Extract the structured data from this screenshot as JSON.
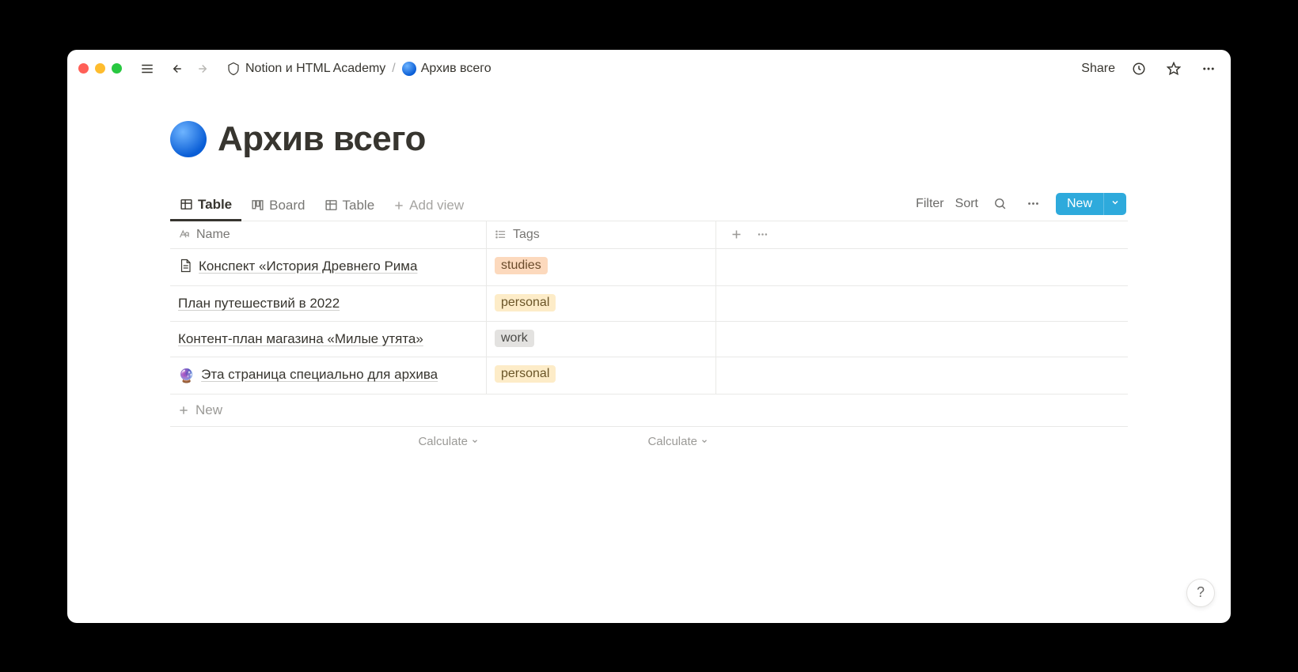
{
  "breadcrumb": {
    "root": "Notion и HTML Academy",
    "current": "Архив всего"
  },
  "topbar": {
    "share": "Share"
  },
  "page": {
    "title": "Архив всего"
  },
  "views": {
    "items": [
      {
        "label": "Table",
        "active": true,
        "type": "table"
      },
      {
        "label": "Board",
        "active": false,
        "type": "board"
      },
      {
        "label": "Table",
        "active": false,
        "type": "table"
      }
    ],
    "add_label": "Add view",
    "filter": "Filter",
    "sort": "Sort",
    "new": "New"
  },
  "columns": {
    "name": "Name",
    "tags": "Tags"
  },
  "rows": [
    {
      "icon": "page",
      "name": "Конспект «История Древнего Рима",
      "tag": "studies",
      "tag_class": "studies"
    },
    {
      "icon": "",
      "name": "План путешествий в 2022",
      "tag": "personal",
      "tag_class": "personal"
    },
    {
      "icon": "",
      "name": "Контент-план магазина «Милые утята»",
      "tag": "work",
      "tag_class": "work"
    },
    {
      "icon": "crystal",
      "name": "Эта страница специально для архива",
      "tag": "personal",
      "tag_class": "personal"
    }
  ],
  "newrow": "New",
  "calculate": "Calculate",
  "help": "?"
}
